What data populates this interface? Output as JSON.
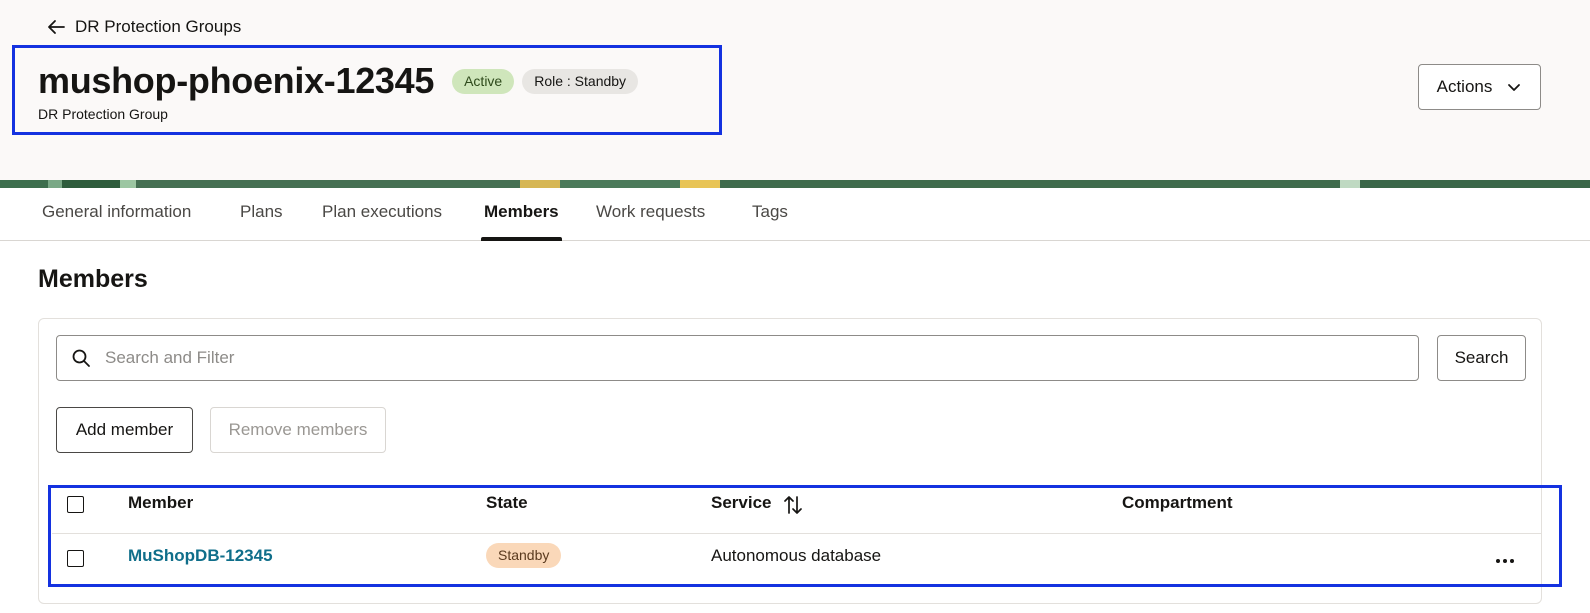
{
  "header": {
    "back_label": "DR Protection Groups",
    "title": "mushop-phoenix-12345",
    "status_badge": "Active",
    "role_badge": "Role : Standby",
    "subtitle": "DR Protection Group",
    "actions_label": "Actions"
  },
  "tabs": [
    {
      "label": "General information",
      "active": false
    },
    {
      "label": "Plans",
      "active": false
    },
    {
      "label": "Plan executions",
      "active": false
    },
    {
      "label": "Members",
      "active": true
    },
    {
      "label": "Work requests",
      "active": false
    },
    {
      "label": "Tags",
      "active": false
    }
  ],
  "section": {
    "title": "Members",
    "search": {
      "placeholder": "Search and Filter",
      "value": "",
      "button_label": "Search"
    },
    "add_label": "Add member",
    "remove_label": "Remove members"
  },
  "table": {
    "columns": [
      "Member",
      "State",
      "Service",
      "Compartment"
    ],
    "rows": [
      {
        "member": "MuShopDB-12345",
        "state": "Standby",
        "service": "Autonomous database",
        "compartment": ""
      }
    ]
  },
  "colors": {
    "link": "#0f6e8a",
    "active_badge": "#cfe6bb",
    "standby_badge": "#fad8b9",
    "highlight_box": "#1432e0"
  }
}
